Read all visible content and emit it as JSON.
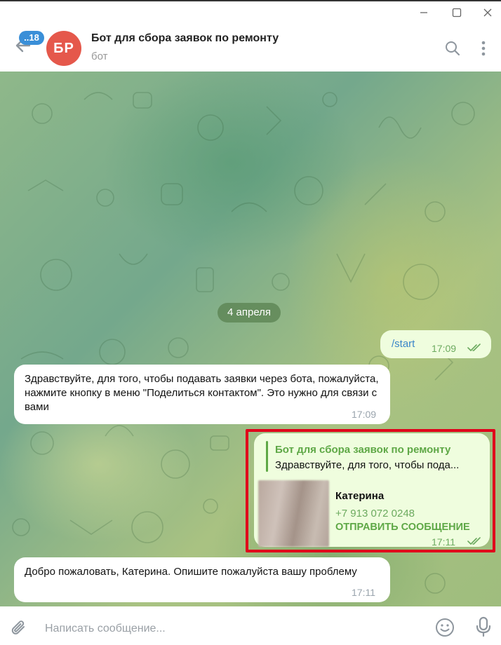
{
  "header": {
    "unread_badge": "..18",
    "avatar_initials": "БР",
    "title": "Бот для сбора заявок по ремонту",
    "subtitle": "бот"
  },
  "chat": {
    "date_separator": "4 апреля",
    "messages": [
      {
        "direction": "out",
        "text": "/start",
        "time": "17:09",
        "read": true
      },
      {
        "direction": "in",
        "text": "Здравствуйте, для того, чтобы подавать заявки через бота, пожалуйста, нажмите кнопку в меню \"Поделиться контактом\". Это нужно для связи с вами",
        "time": "17:09"
      },
      {
        "direction": "out",
        "type": "contact",
        "reply_from": "Бот для сбора заявок по ремонту",
        "reply_text": "Здравствуйте, для того, чтобы пода...",
        "contact_name": "Катерина",
        "contact_phone": "+7 913 072 0248",
        "action": "ОТПРАВИТЬ СООБЩЕНИЕ",
        "time": "17:11",
        "read": true
      },
      {
        "direction": "in",
        "text": "Добро пожаловать, Катерина. Опишите пожалуйста вашу проблему",
        "time": "17:11"
      }
    ]
  },
  "composer": {
    "placeholder": "Написать сообщение..."
  },
  "colors": {
    "accent": "#3a8fd8",
    "avatar": "#e5584b",
    "outgoing_bubble": "#effdde",
    "highlight": "#e0001b",
    "link_green": "#5ea846"
  }
}
